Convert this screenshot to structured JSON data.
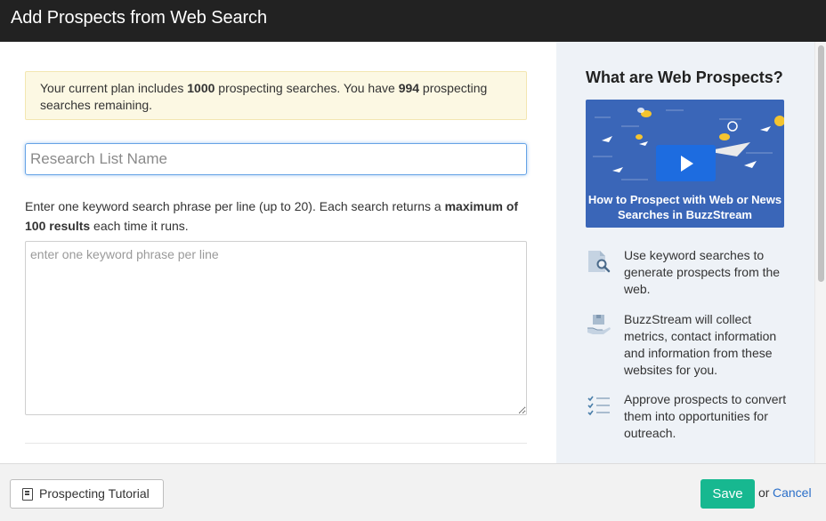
{
  "dialog": {
    "title": "Add Prospects from Web Search"
  },
  "notice": {
    "prefix": "Your current plan includes ",
    "total_searches": "1000",
    "middle": " prospecting searches. You have ",
    "remaining_searches": "994",
    "suffix": " prospecting searches remaining."
  },
  "form": {
    "list_name_placeholder": "Research List Name",
    "list_name_value": "",
    "help_prefix": "Enter one keyword search phrase per line (up to 20). Each search returns a ",
    "help_bold": "maximum of 100 results",
    "help_suffix": " each time it runs.",
    "keywords_placeholder": "enter one keyword phrase per line",
    "keywords_value": ""
  },
  "sidebar": {
    "heading": "What are Web Prospects?",
    "video_caption": "How to Prospect with Web or News Searches in BuzzStream",
    "features": [
      {
        "icon": "document-search-icon",
        "text": "Use keyword searches to generate prospects from the web."
      },
      {
        "icon": "hand-box-icon",
        "text": "BuzzStream will collect metrics, contact information and information from these websites for you."
      },
      {
        "icon": "checklist-icon",
        "text": "Approve prospects to convert them into opportunities for outreach."
      }
    ]
  },
  "footer": {
    "tutorial_label": "Prospecting Tutorial",
    "save_label": "Save",
    "or_text": "or",
    "cancel_label": "Cancel"
  },
  "colors": {
    "titlebar": "#222222",
    "notice_bg": "#fcf8e3",
    "sidebar_bg": "#eef2f7",
    "save_button": "#17b890",
    "link": "#2a6fc9",
    "video_bg": "#3a66b8"
  }
}
